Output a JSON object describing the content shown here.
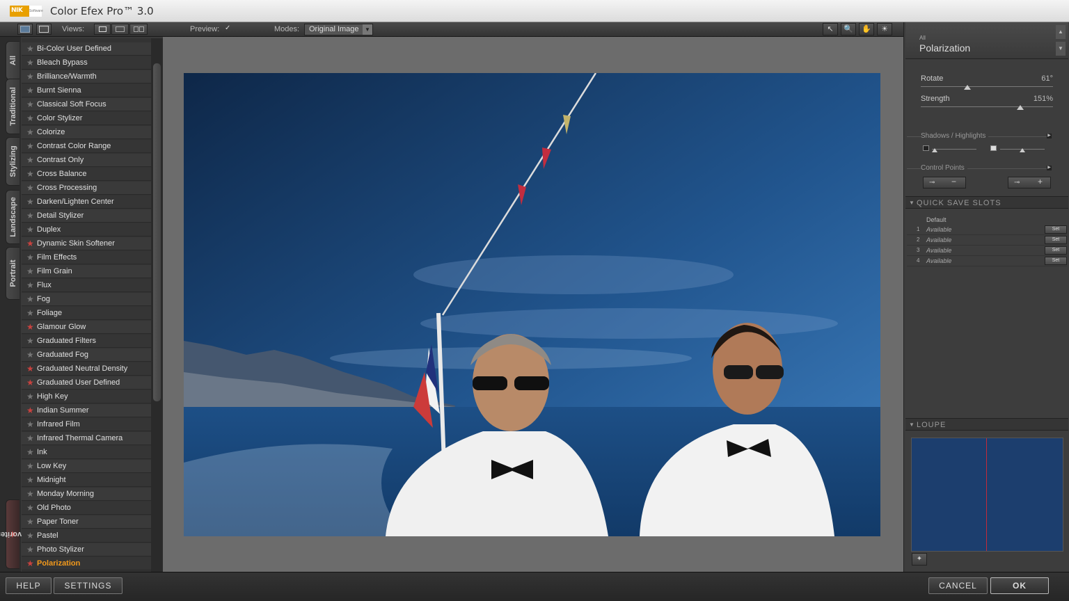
{
  "app": {
    "title": "Color Efex Pro™ 3.0",
    "logo_text": "NIK",
    "logo_sub": "Software"
  },
  "toolbar": {
    "views_label": "Views:",
    "preview_label": "Preview:",
    "preview_checked": "✓",
    "modes_label": "Modes:",
    "modes_value": "Original Image",
    "tools": [
      "↖",
      "🔍",
      "✋",
      "☀"
    ]
  },
  "tabs": [
    "All",
    "Traditional",
    "Stylizing",
    "Landscape",
    "Portrait",
    "Favorites"
  ],
  "filters": [
    {
      "name": "Bi-Color User Defined",
      "fav": false
    },
    {
      "name": "Bleach Bypass",
      "fav": false
    },
    {
      "name": "Brilliance/Warmth",
      "fav": false
    },
    {
      "name": "Burnt Sienna",
      "fav": false
    },
    {
      "name": "Classical Soft Focus",
      "fav": false
    },
    {
      "name": "Color Stylizer",
      "fav": false
    },
    {
      "name": "Colorize",
      "fav": false
    },
    {
      "name": "Contrast Color Range",
      "fav": false
    },
    {
      "name": "Contrast Only",
      "fav": false
    },
    {
      "name": "Cross Balance",
      "fav": false
    },
    {
      "name": "Cross Processing",
      "fav": false
    },
    {
      "name": "Darken/Lighten Center",
      "fav": false
    },
    {
      "name": "Detail Stylizer",
      "fav": false
    },
    {
      "name": "Duplex",
      "fav": false
    },
    {
      "name": "Dynamic Skin Softener",
      "fav": true
    },
    {
      "name": "Film Effects",
      "fav": false
    },
    {
      "name": "Film Grain",
      "fav": false
    },
    {
      "name": "Flux",
      "fav": false
    },
    {
      "name": "Fog",
      "fav": false
    },
    {
      "name": "Foliage",
      "fav": false
    },
    {
      "name": "Glamour Glow",
      "fav": true
    },
    {
      "name": "Graduated Filters",
      "fav": false
    },
    {
      "name": "Graduated Fog",
      "fav": false
    },
    {
      "name": "Graduated Neutral Density",
      "fav": true
    },
    {
      "name": "Graduated User Defined",
      "fav": true
    },
    {
      "name": "High Key",
      "fav": false
    },
    {
      "name": "Indian Summer",
      "fav": true
    },
    {
      "name": "Infrared Film",
      "fav": false
    },
    {
      "name": "Infrared Thermal Camera",
      "fav": false
    },
    {
      "name": "Ink",
      "fav": false
    },
    {
      "name": "Low Key",
      "fav": false
    },
    {
      "name": "Midnight",
      "fav": false
    },
    {
      "name": "Monday Morning",
      "fav": false
    },
    {
      "name": "Old Photo",
      "fav": false
    },
    {
      "name": "Paper Toner",
      "fav": false
    },
    {
      "name": "Pastel",
      "fav": false
    },
    {
      "name": "Photo Stylizer",
      "fav": false
    },
    {
      "name": "Polarization",
      "fav": true,
      "active": true
    }
  ],
  "panel": {
    "category": "All",
    "filter_name": "Polarization",
    "rotate": {
      "label": "Rotate",
      "value": "61°",
      "fraction": 0.35
    },
    "strength": {
      "label": "Strength",
      "value": "151%",
      "fraction": 0.75
    },
    "shadows_highlights": "Shadows / Highlights",
    "control_points": "Control Points",
    "quick_save_title": "QUICK SAVE SLOTS",
    "default_label": "Default",
    "slots": [
      {
        "num": "1",
        "status": "Available",
        "btn": "Set"
      },
      {
        "num": "2",
        "status": "Available",
        "btn": "Set"
      },
      {
        "num": "3",
        "status": "Available",
        "btn": "Set"
      },
      {
        "num": "4",
        "status": "Available",
        "btn": "Set"
      }
    ],
    "loupe_title": "LOUPE"
  },
  "bottom": {
    "help": "HELP",
    "settings": "SETTINGS",
    "cancel": "CANCEL",
    "ok": "OK"
  },
  "colors": {
    "accent": "#f39a1c",
    "favorite": "#c9423f"
  }
}
